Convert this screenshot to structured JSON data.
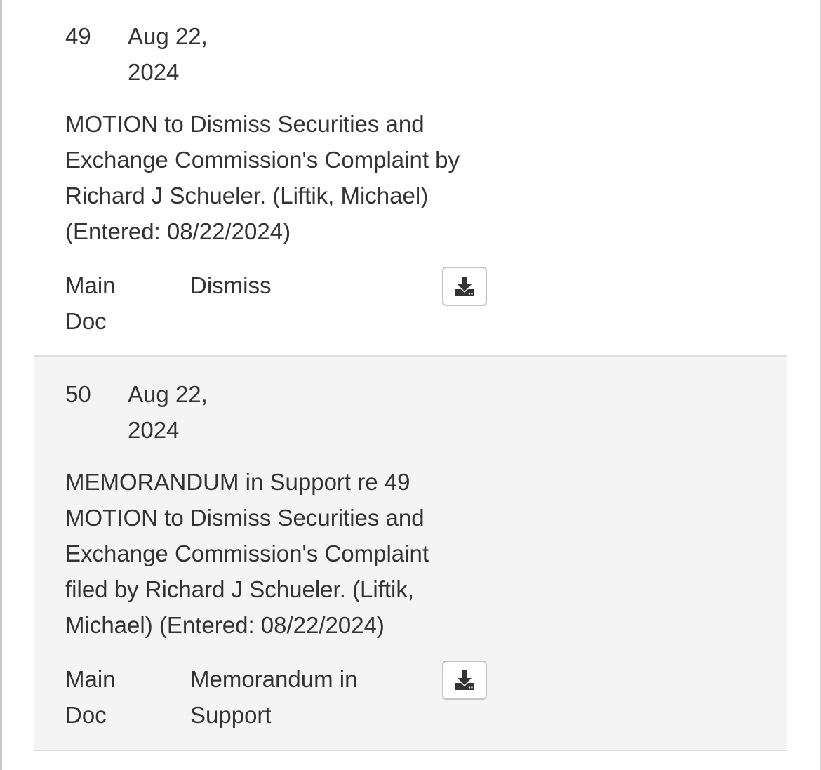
{
  "entries": [
    {
      "number": "49",
      "date_line1": "Aug 22,",
      "date_line2": "2024",
      "description_lines": [
        "MOTION to Dismiss Securities and",
        "Exchange Commission's Complaint by",
        "Richard J Schueler. (Liftik, Michael)",
        "(Entered: 08/22/2024)"
      ],
      "doc_type_line1": "Main",
      "doc_type_line2": "Doc",
      "doc_desc_lines": [
        "Dismiss"
      ],
      "download_icon": "download-icon"
    },
    {
      "number": "50",
      "date_line1": "Aug 22,",
      "date_line2": "2024",
      "description_lines": [
        "MEMORANDUM in Support re 49",
        "MOTION to Dismiss Securities and",
        "Exchange Commission's Complaint",
        "filed by Richard J Schueler. (Liftik,",
        "Michael) (Entered: 08/22/2024)"
      ],
      "doc_type_line1": "Main",
      "doc_type_line2": "Doc",
      "doc_desc_lines": [
        "Memorandum in",
        "Support"
      ],
      "download_icon": "download-icon"
    }
  ],
  "colors": {
    "text": "#333333",
    "row_alt_background": "#f4f4f4",
    "divider": "#dddddd",
    "button_border": "#c4c4c4"
  }
}
